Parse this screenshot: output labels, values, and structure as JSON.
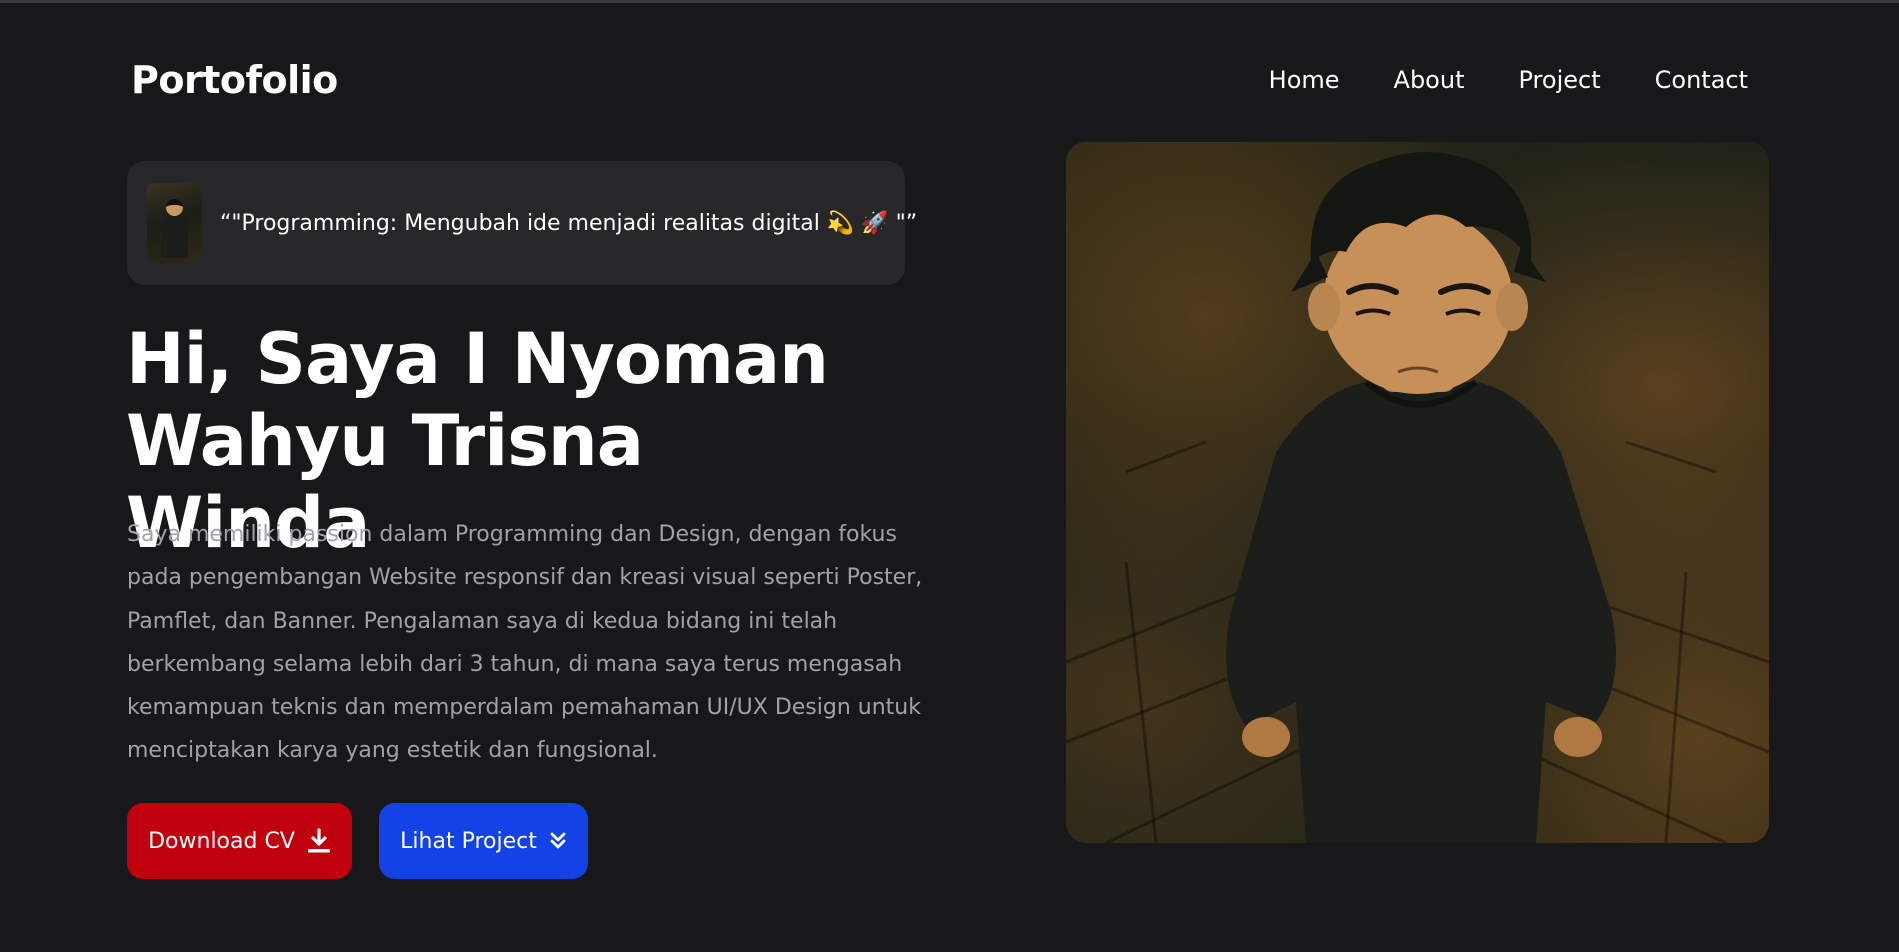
{
  "app": {
    "brand": "Portofolio"
  },
  "nav": {
    "items": [
      {
        "label": "Home"
      },
      {
        "label": "About"
      },
      {
        "label": "Project"
      },
      {
        "label": "Contact"
      }
    ]
  },
  "quote": {
    "text": "“\"Programming: Mengubah ide menjadi realitas digital 💫 🚀 \"”"
  },
  "hero": {
    "title_line1": "Hi, Saya I Nyoman",
    "title_line2": "Wahyu Trisna Winda",
    "description": "Saya memiliki passion dalam Programming dan Design, dengan fokus pada pengembangan Website responsif dan kreasi visual seperti Poster, Pamflet, dan Banner. Pengalaman saya di kedua bidang ini telah berkembang selama lebih dari 3 tahun, di mana saya terus mengasah kemampuan teknis dan memperdalam pemahaman UI/UX Design untuk menciptakan karya yang estetik dan fungsional."
  },
  "buttons": {
    "download_cv": {
      "label": "Download CV",
      "icon": "download-icon"
    },
    "view_project": {
      "label": "Lihat Project",
      "icon": "double-chevron-down-icon"
    }
  },
  "colors": {
    "background": "#18181b",
    "card": "#27272a",
    "download_button": "#c1000d",
    "project_button": "#1342e6",
    "muted_text": "#a1a1aa"
  }
}
